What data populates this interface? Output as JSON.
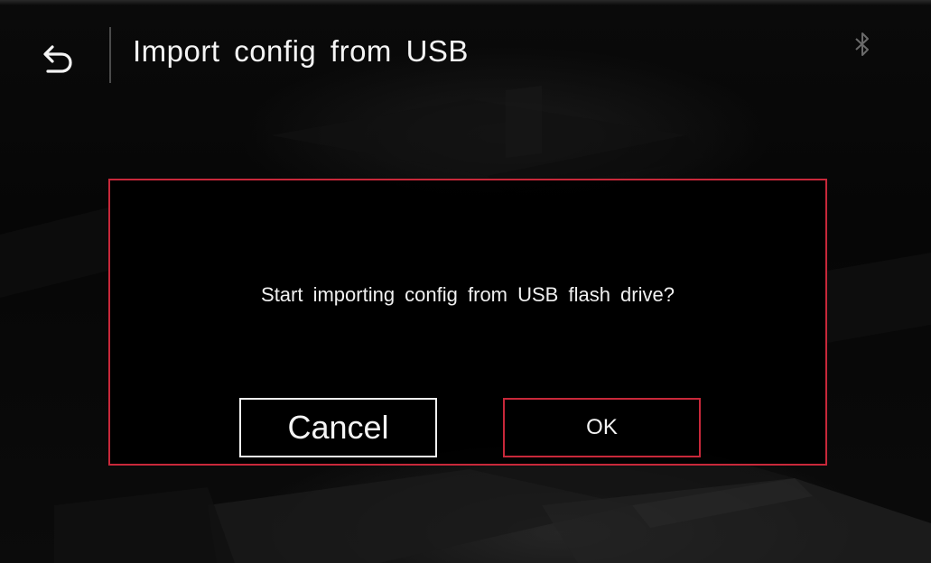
{
  "header": {
    "title": "Import config from USB",
    "back_icon": "back-arrow-icon",
    "status_icon": "bluetooth-icon"
  },
  "dialog": {
    "message": "Start importing config from USB flash drive?",
    "cancel_label": "Cancel",
    "ok_label": "OK"
  },
  "colors": {
    "accent": "#c8283a",
    "background": "#000000",
    "text": "#f2f2f2"
  }
}
